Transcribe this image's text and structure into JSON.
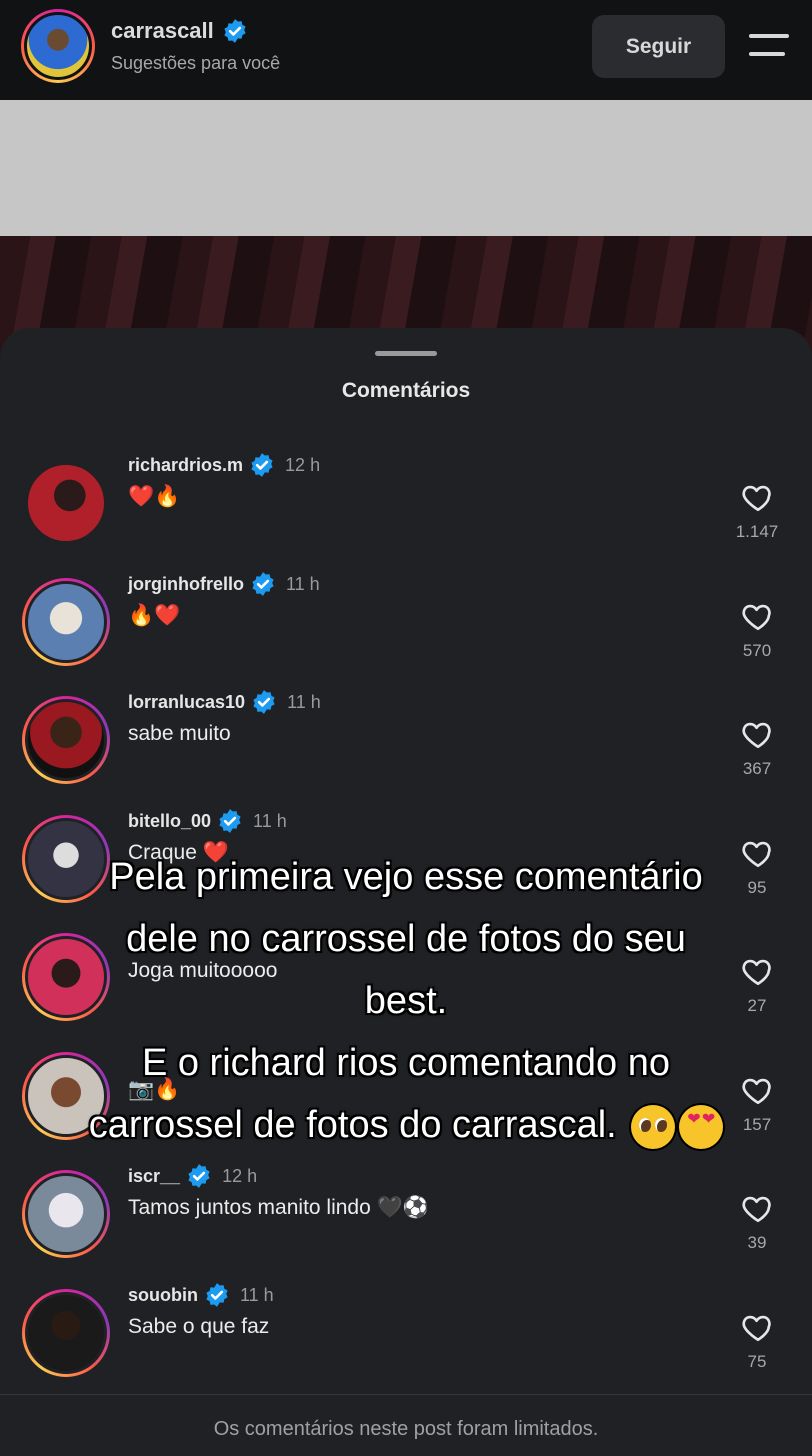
{
  "header": {
    "username": "carrascall",
    "subtitle": "Sugestões para você",
    "follow_label": "Seguir"
  },
  "sheet": {
    "title": "Comentários",
    "footer": "Os comentários neste post foram limitados."
  },
  "comments": [
    {
      "user": "richardrios.m",
      "time": "12 h",
      "text": "❤️🔥",
      "likes": "1.147",
      "verified": true
    },
    {
      "user": "jorginhofrello",
      "time": "11 h",
      "text": "🔥❤️",
      "likes": "570",
      "verified": true
    },
    {
      "user": "lorranlucas10",
      "time": "11 h",
      "text": "sabe muito",
      "likes": "367",
      "verified": true
    },
    {
      "user": "bitello_00",
      "time": "11 h",
      "text": "Craque ❤️",
      "likes": "95",
      "verified": true
    },
    {
      "user": "",
      "time": "",
      "text": "Joga muitooooo",
      "likes": "27",
      "verified": false
    },
    {
      "user": "",
      "time": "",
      "text": "📷🔥",
      "likes": "157",
      "verified": false
    },
    {
      "user": "iscr__",
      "time": "12 h",
      "text": "Tamos juntos manito lindo 🖤⚽",
      "likes": "39",
      "verified": true
    },
    {
      "user": "souobin",
      "time": "11 h",
      "text": "Sabe o que faz",
      "likes": "75",
      "verified": true
    }
  ],
  "caption": {
    "line1": "Pela primeira vejo esse comentário",
    "line2": "dele no carrossel de fotos do seu",
    "line3": "best.",
    "line4": "E o richard rios comentando no",
    "line5": "carrossel de fotos do carrascal."
  },
  "icons": {
    "verified": "verified-badge-icon",
    "like": "heart-outline-icon",
    "menu": "menu-icon"
  },
  "colors": {
    "verified": "#1d9bf0",
    "sheet_bg": "#1f2124",
    "header_bg": "#111214"
  }
}
